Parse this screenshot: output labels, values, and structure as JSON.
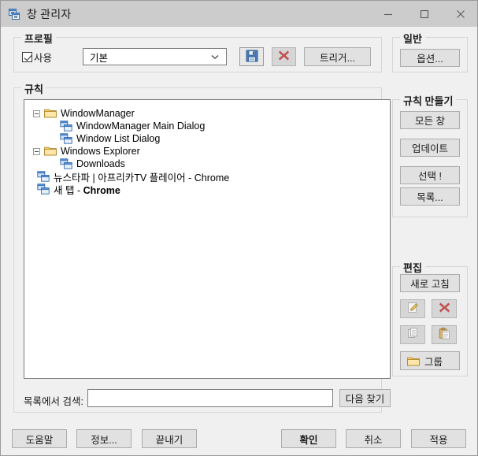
{
  "window": {
    "title": "창 관리자",
    "icon": "window-manager-icon",
    "controls": {
      "minimize": "minimize-icon",
      "maximize": "maximize-icon",
      "close": "close-icon"
    }
  },
  "profile": {
    "group_title": "프로필",
    "use_checkbox_label": "사용",
    "use_checkbox_checked": true,
    "combo_value": "기본",
    "combo_placeholder": "기본",
    "save_icon": "save-floppy-icon",
    "delete_icon": "delete-x-icon",
    "trigger_button": "트리거..."
  },
  "general": {
    "group_title": "일반",
    "options_button": "옵션..."
  },
  "rules": {
    "group_title": "규칙",
    "tree": [
      {
        "label": "WindowManager",
        "type": "folder",
        "depth": 0,
        "expanded": true,
        "bold": false
      },
      {
        "label": "WindowManager Main Dialog",
        "type": "window",
        "depth": 1,
        "bold": false
      },
      {
        "label": "Window List Dialog",
        "type": "window",
        "depth": 1,
        "bold": false
      },
      {
        "label": "Windows Explorer",
        "type": "folder",
        "depth": 0,
        "expanded": true,
        "bold": false
      },
      {
        "label": "Downloads",
        "type": "window",
        "depth": 1,
        "bold": false
      },
      {
        "label": "뉴스타파 | 아프리카TV 플레이어 - Chrome",
        "type": "window",
        "depth": 0,
        "bold": false
      },
      {
        "label": "새 탭 - ",
        "label_bold": "Chrome",
        "type": "window",
        "depth": 0,
        "bold": true
      }
    ],
    "search_label": "목록에서 검색:",
    "search_value": "",
    "search_placeholder": "",
    "find_next_button": "다음 찾기"
  },
  "create_rules": {
    "group_title": "규칙 만들기",
    "buttons": [
      {
        "label": "모든 창",
        "name": "all-windows-button"
      },
      {
        "label": "업데이트",
        "name": "update-button"
      },
      {
        "label": "선택 !",
        "name": "select-button"
      },
      {
        "label": "목록...",
        "name": "list-button"
      }
    ]
  },
  "edit": {
    "group_title": "편집",
    "refresh_button": "새로 고침",
    "icons": {
      "edit": "pencil-edit-icon",
      "delete": "delete-x-icon",
      "copy": "copy-icon",
      "paste": "paste-icon"
    },
    "group_button": "그룹",
    "group_button_icon": "folder-icon"
  },
  "footer": {
    "help_button": "도움말",
    "about_button": "정보...",
    "exit_button": "끝내기",
    "ok_button": "확인",
    "cancel_button": "취소",
    "apply_button": "적용"
  },
  "colors": {
    "titlebar": "#cccccc",
    "dialog_bg": "#f0f0f0",
    "button_face": "#e1e1e1",
    "button_border": "#adadad",
    "field_bg": "#ffffff",
    "field_border": "#7a7a7a",
    "folder_yellow": "#ffd16b",
    "window_blue": "#3a7fd5",
    "delete_red": "#c0504d",
    "save_blue": "#4a7ebb"
  }
}
